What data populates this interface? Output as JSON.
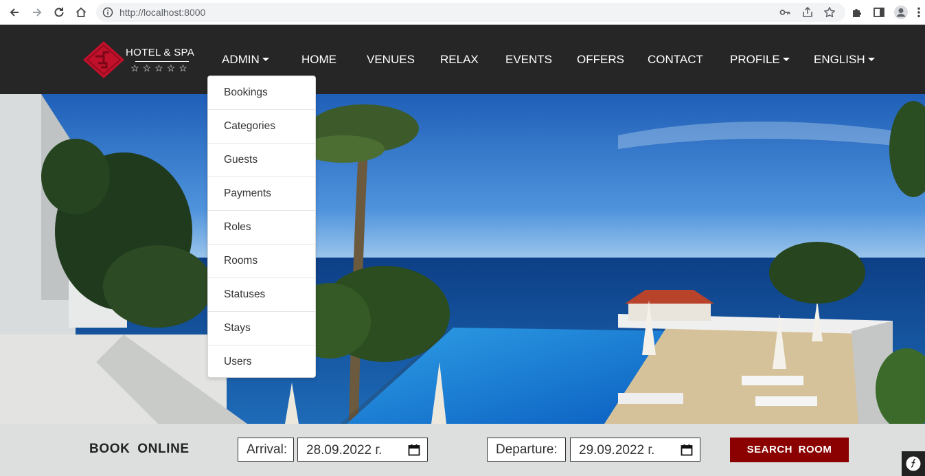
{
  "browser": {
    "url": "http://localhost:8000"
  },
  "brand": {
    "name": "HOTEL & SPA",
    "stars": "☆☆☆☆☆",
    "accent": "#c0102a"
  },
  "nav": {
    "admin": "ADMIN",
    "home": "HOME",
    "venues": "VENUES",
    "relax": "RELAX",
    "events": "EVENTS",
    "offers": "OFFERS",
    "contact": "CONTACT",
    "profile": "PROFILE",
    "language": "ENGLISH"
  },
  "admin_menu": {
    "items": [
      "Bookings",
      "Categories",
      "Guests",
      "Payments",
      "Roles",
      "Rooms",
      "Statuses",
      "Stays",
      "Users"
    ]
  },
  "booking": {
    "title": "BOOK ONLINE",
    "arrival_label": "Arrival:",
    "arrival_value": "28.09.2022 г.",
    "departure_label": "Departure:",
    "departure_value": "29.09.2022 г.",
    "search_label": "SEARCH ROOM",
    "button_color": "#8b0000"
  }
}
